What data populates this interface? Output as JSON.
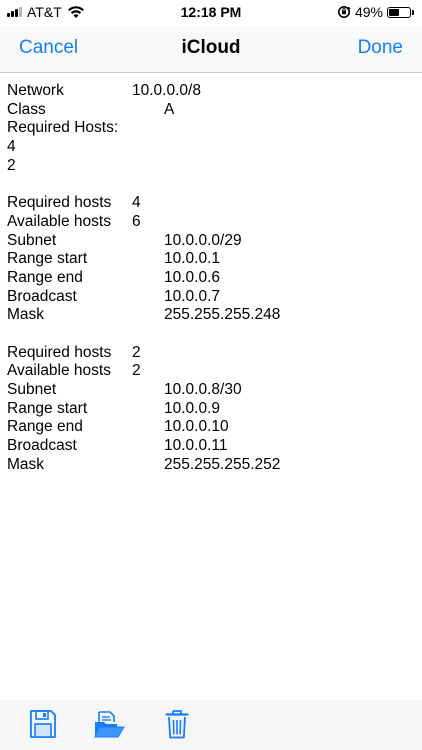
{
  "status_bar": {
    "carrier": "AT&T",
    "time": "12:18 PM",
    "battery_percent": "49%",
    "battery_level": 0.49,
    "signal_bars": 3
  },
  "nav": {
    "cancel_label": "Cancel",
    "title": "iCloud",
    "done_label": "Done"
  },
  "network": {
    "network_label": "Network",
    "network_value": "10.0.0.0/8",
    "class_label": "Class",
    "class_value": "A",
    "required_hosts_label": "Required Hosts:",
    "required_hosts_list": [
      "4",
      "2"
    ]
  },
  "subnets": [
    {
      "required_hosts_label": "Required hosts",
      "required_hosts": "4",
      "available_hosts_label": "Available hosts",
      "available_hosts": "6",
      "subnet_label": "Subnet",
      "subnet": "10.0.0.0/29",
      "range_start_label": "Range start",
      "range_start": "10.0.0.1",
      "range_end_label": "Range end",
      "range_end": "10.0.0.6",
      "broadcast_label": "Broadcast",
      "broadcast": "10.0.0.7",
      "mask_label": "Mask",
      "mask": "255.255.255.248"
    },
    {
      "required_hosts_label": "Required hosts",
      "required_hosts": "2",
      "available_hosts_label": "Available hosts",
      "available_hosts": "2",
      "subnet_label": "Subnet",
      "subnet": "10.0.0.8/30",
      "range_start_label": "Range start",
      "range_start": "10.0.0.9",
      "range_end_label": "Range end",
      "range_end": "10.0.0.10",
      "broadcast_label": "Broadcast",
      "broadcast": "10.0.0.11",
      "mask_label": "Mask",
      "mask": "255.255.255.252"
    }
  ],
  "toolbar": {
    "icons": [
      "save-icon",
      "open-folder-icon",
      "trash-icon"
    ],
    "accent_color": "#147efb"
  }
}
